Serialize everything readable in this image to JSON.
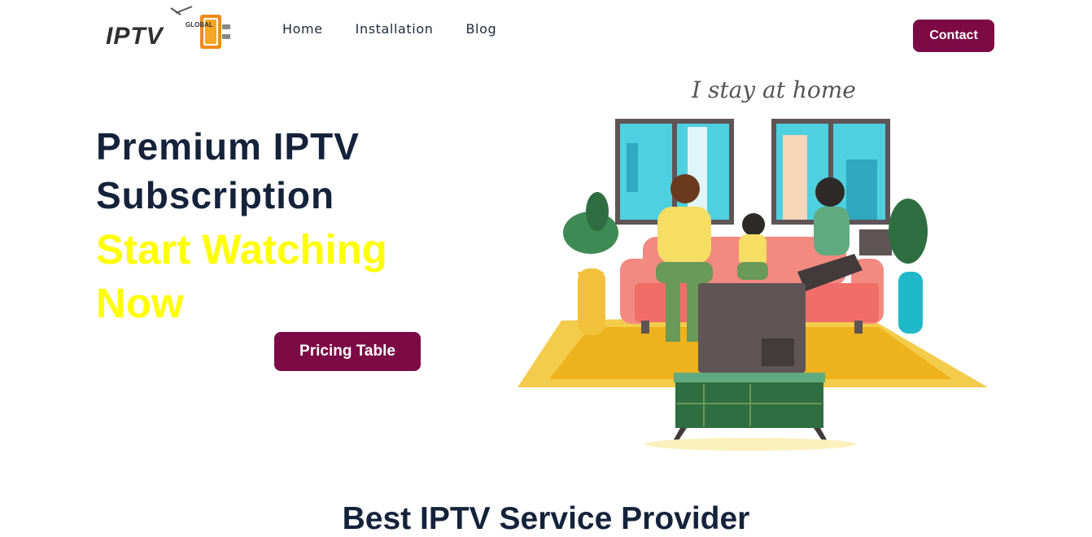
{
  "header": {
    "logo_text": "IPTV",
    "logo_small_text": "GLOBAL",
    "nav": [
      {
        "label": "Home"
      },
      {
        "label": "Installation"
      },
      {
        "label": "Blog"
      }
    ],
    "contact_label": "Contact"
  },
  "hero": {
    "title_line1": "Premium IPTV",
    "title_line2": "Subscription",
    "subtitle_line1": "Start Watching",
    "subtitle_line2": "Now",
    "cta_label": "Pricing Table",
    "illustration_caption": "I stay at home"
  },
  "section": {
    "title": "Best IPTV Service Provider"
  },
  "colors": {
    "brand": "#7c0a45",
    "heading": "#14233a",
    "highlight": "#ffff00"
  },
  "icons": [
    "logo-tv-icon",
    "family-living-room-illustration"
  ]
}
